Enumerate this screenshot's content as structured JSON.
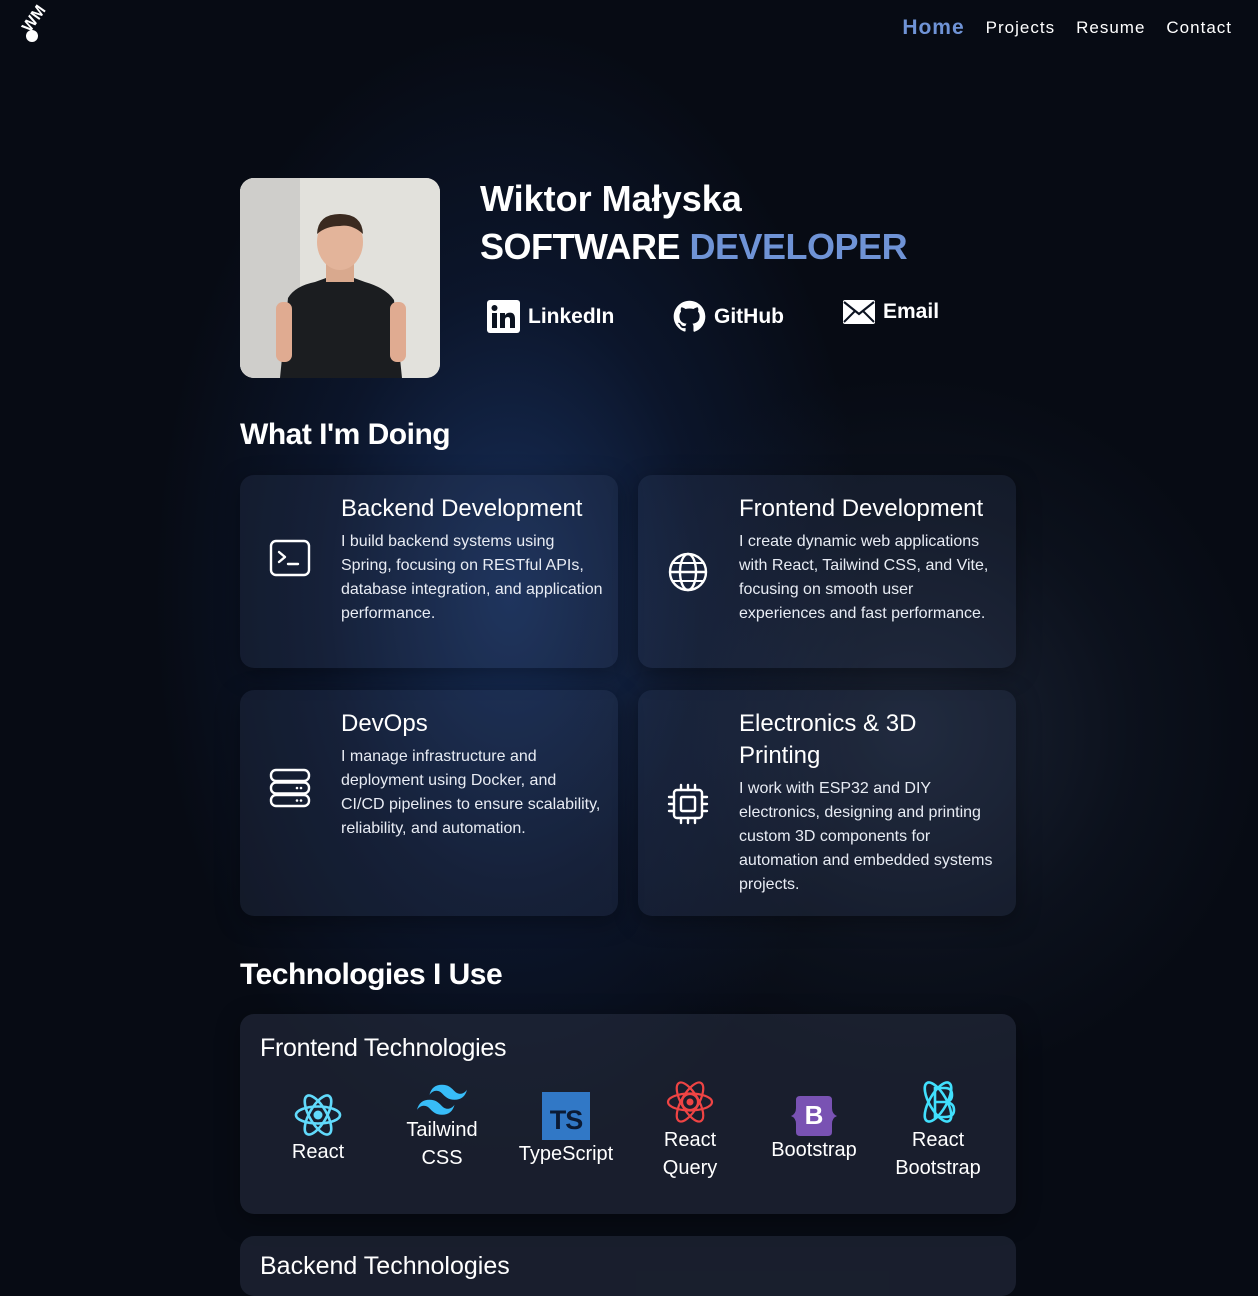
{
  "logo": {
    "text": "WM"
  },
  "nav": {
    "home": "Home",
    "projects": "Projects",
    "resume": "Resume",
    "contact": "Contact"
  },
  "hero": {
    "name": "Wiktor Małyska",
    "role_main": "SOFTWARE",
    "role_accent": "DEVELOPER",
    "links": {
      "linkedin": "LinkedIn",
      "github": "GitHub",
      "email": "Email"
    }
  },
  "doing": {
    "heading": "What I'm Doing",
    "cards": [
      {
        "title": "Backend Development",
        "desc": "I build backend systems using Spring, focusing on RESTful APIs, database integration, and application performance.",
        "icon": "terminal-icon"
      },
      {
        "title": "Frontend Development",
        "desc": "I create dynamic web applications with React, Tailwind CSS, and Vite, focusing on smooth user experiences and fast performance.",
        "icon": "globe-icon"
      },
      {
        "title": "DevOps",
        "desc": "I manage infrastructure and deployment using Docker, and CI/CD pipelines to ensure scalability, reliability, and automation.",
        "icon": "server-icon"
      },
      {
        "title": "Electronics & 3D Printing",
        "desc": "I work with ESP32 and DIY electronics, designing and printing custom 3D components for automation and embedded systems projects.",
        "icon": "chip-icon"
      }
    ]
  },
  "tech": {
    "heading": "Technologies I Use",
    "frontend_title": "Frontend Technologies",
    "frontend": [
      "React",
      "Tailwind CSS",
      "TypeScript",
      "React Query",
      "Bootstrap",
      "React Bootstrap"
    ],
    "ts_badge": "TS",
    "bootstrap_badge": "B",
    "backend_title": "Backend Technologies"
  },
  "colors": {
    "accent": "#6f93d6",
    "react": "#61dafb",
    "tailwind": "#38bdf8",
    "typescript": "#3178c6",
    "react_query": "#ef4444",
    "bootstrap": "#7952b3"
  }
}
